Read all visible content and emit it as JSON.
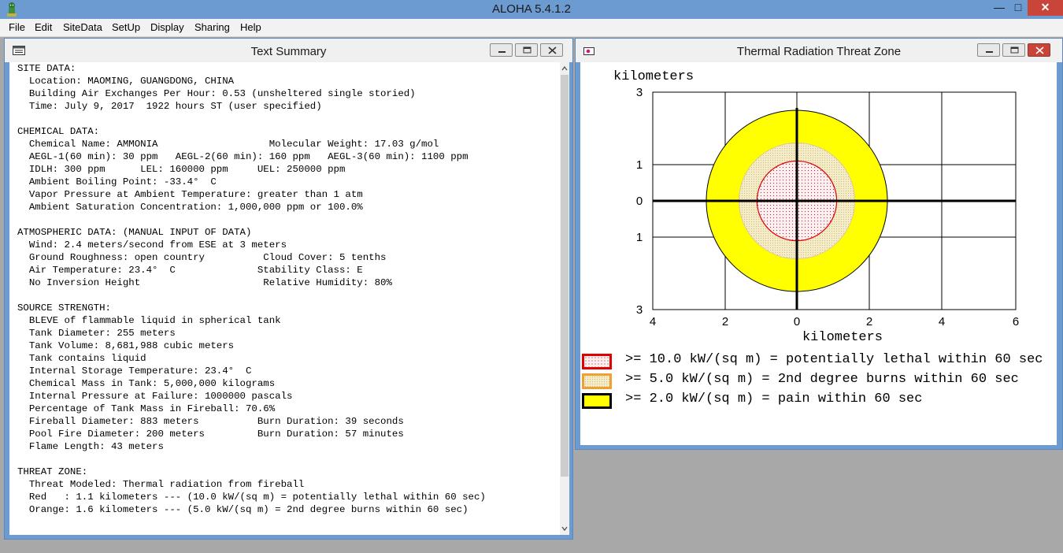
{
  "app": {
    "title": "ALOHA 5.4.1.2",
    "min_glyph": "—",
    "max_glyph": "□",
    "close_glyph": "✕"
  },
  "menu": [
    "File",
    "Edit",
    "SiteData",
    "SetUp",
    "Display",
    "Sharing",
    "Help"
  ],
  "text_summary": {
    "title": "Text Summary",
    "lines": [
      "SITE DATA:",
      "  Location: MAOMING, GUANGDONG, CHINA",
      "  Building Air Exchanges Per Hour: 0.53 (unsheltered single storied)",
      "  Time: July 9, 2017  1922 hours ST (user specified)",
      "",
      "CHEMICAL DATA:",
      "  Chemical Name: AMMONIA                   Molecular Weight: 17.03 g/mol",
      "  AEGL-1(60 min): 30 ppm   AEGL-2(60 min): 160 ppm   AEGL-3(60 min): 1100 ppm",
      "  IDLH: 300 ppm      LEL: 160000 ppm     UEL: 250000 ppm",
      "  Ambient Boiling Point: -33.4°  C",
      "  Vapor Pressure at Ambient Temperature: greater than 1 atm",
      "  Ambient Saturation Concentration: 1,000,000 ppm or 100.0%",
      "",
      "ATMOSPHERIC DATA: (MANUAL INPUT OF DATA)",
      "  Wind: 2.4 meters/second from ESE at 3 meters",
      "  Ground Roughness: open country          Cloud Cover: 5 tenths",
      "  Air Temperature: 23.4°  C              Stability Class: E",
      "  No Inversion Height                     Relative Humidity: 80%",
      "",
      "SOURCE STRENGTH:",
      "  BLEVE of flammable liquid in spherical tank",
      "  Tank Diameter: 255 meters",
      "  Tank Volume: 8,681,988 cubic meters",
      "  Tank contains liquid",
      "  Internal Storage Temperature: 23.4°  C",
      "  Chemical Mass in Tank: 5,000,000 kilograms",
      "  Internal Pressure at Failure: 1000000 pascals",
      "  Percentage of Tank Mass in Fireball: 70.6%",
      "  Fireball Diameter: 883 meters          Burn Duration: 39 seconds",
      "  Pool Fire Diameter: 200 meters         Burn Duration: 57 minutes",
      "  Flame Length: 43 meters",
      "",
      "THREAT ZONE:",
      "  Threat Modeled: Thermal radiation from fireball",
      "  Red   : 1.1 kilometers --- (10.0 kW/(sq m) = potentially lethal within 60 sec)",
      "  Orange: 1.6 kilometers --- (5.0 kW/(sq m) = 2nd degree burns within 60 sec)"
    ]
  },
  "threat_zone": {
    "title": "Thermal Radiation Threat Zone",
    "y_axis_label": "kilometers",
    "x_axis_label": "kilometers",
    "y_ticks": [
      "3",
      "1",
      "0",
      "1",
      "3"
    ],
    "x_ticks": [
      "4",
      "2",
      "0",
      "2",
      "4",
      "6"
    ],
    "zones_km": {
      "red": 1.1,
      "orange": 1.6,
      "yellow": 2.5
    },
    "colors": {
      "red": "#e00000",
      "orange": "#f0a030",
      "yellow": "#ffff00",
      "orange_fill": "#f3ecc8",
      "red_fill": "#fbeef0"
    },
    "legend": [
      {
        "text": ">= 10.0 kW/(sq m) = potentially lethal within 60 sec",
        "zone": "red"
      },
      {
        "text": ">= 5.0 kW/(sq m) = 2nd degree burns within 60 sec",
        "zone": "orange"
      },
      {
        "text": ">= 2.0 kW/(sq m) = pain within 60 sec",
        "zone": "yellow"
      }
    ]
  }
}
